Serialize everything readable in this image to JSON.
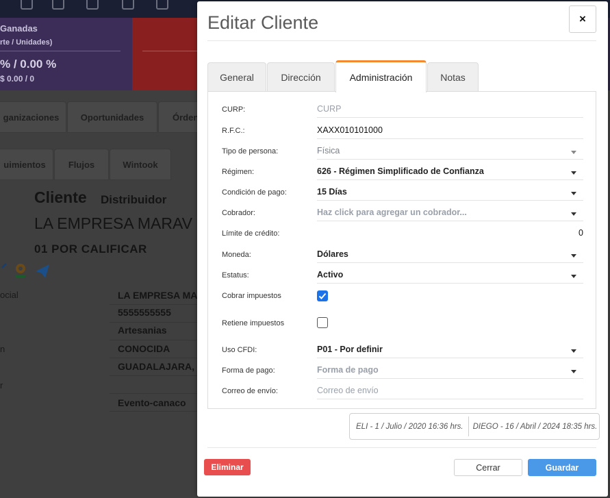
{
  "background": {
    "stats": {
      "title": "Ganadas",
      "subtitle": "rte / Unidades)",
      "value": "% / 0.00 %",
      "value_sub": "$ 0.00 / 0"
    },
    "tabs_row1": [
      "ganizaciones",
      "Oportunidades",
      "Órden"
    ],
    "tabs_row2": [
      "uimientos",
      "Flujos",
      "Wintook"
    ],
    "heading": {
      "type": "Cliente",
      "category": "Distribuidor"
    },
    "company_name": "LA EMPRESA MARAV",
    "stage": "01 POR CALIFICAR",
    "rows": [
      {
        "label": "ocial",
        "value": "LA EMPRESA MA"
      },
      {
        "label": "",
        "value": "5555555555"
      },
      {
        "label": "",
        "value": "Artesanias"
      },
      {
        "label": "n",
        "value": "CONOCIDA"
      },
      {
        "label": "",
        "value": "GUADALAJARA,"
      },
      {
        "label": "r",
        "value": ""
      },
      {
        "label": "",
        "value": "Evento-canaco"
      }
    ]
  },
  "modal": {
    "title": "Editar Cliente",
    "close_symbol": "×",
    "tabs": [
      {
        "label": "General",
        "active": false
      },
      {
        "label": "Dirección",
        "active": false
      },
      {
        "label": "Administración",
        "active": true
      },
      {
        "label": "Notas",
        "active": false
      }
    ],
    "fields": {
      "curp": {
        "label": "CURP:",
        "placeholder": "CURP"
      },
      "rfc": {
        "label": "R.F.C.:",
        "value": "XAXX010101000"
      },
      "tipo_persona": {
        "label": "Tipo de persona:",
        "value": "Física"
      },
      "regimen": {
        "label": "Régimen:",
        "value": "626 - Régimen Simplificado de Confianza"
      },
      "condicion_pago": {
        "label": "Condición de pago:",
        "value": "15 Días"
      },
      "cobrador": {
        "label": "Cobrador:",
        "placeholder": "Haz click para agregar un cobrador..."
      },
      "limite_credito": {
        "label": "Límite de crédito:",
        "value": "0"
      },
      "moneda": {
        "label": "Moneda:",
        "value": "Dólares"
      },
      "estatus": {
        "label": "Estatus:",
        "value": "Activo"
      },
      "cobrar_impuestos": {
        "label": "Cobrar impuestos",
        "checked": true
      },
      "retiene_impuestos": {
        "label": "Retiene impuestos",
        "checked": false
      },
      "uso_cfdi": {
        "label": "Uso CFDI:",
        "value": "P01 - Por definir"
      },
      "forma_pago": {
        "label": "Forma de pago:",
        "placeholder": "Forma de pago"
      },
      "correo_envio": {
        "label": "Correo de envío:",
        "placeholder": "Correo de envío"
      }
    },
    "audit": {
      "created": "ELI - 1 / Julio / 2020 16:36 hrs.",
      "modified": "DIEGO - 16 / Abril / 2024 18:35 hrs."
    },
    "buttons": {
      "delete": "Eliminar",
      "close": "Cerrar",
      "save": "Guardar"
    }
  },
  "colors": {
    "accent_tab": "#f28b30",
    "primary": "#4a98e8",
    "danger": "#e94e4e",
    "checkbox": "#1a73e8"
  }
}
